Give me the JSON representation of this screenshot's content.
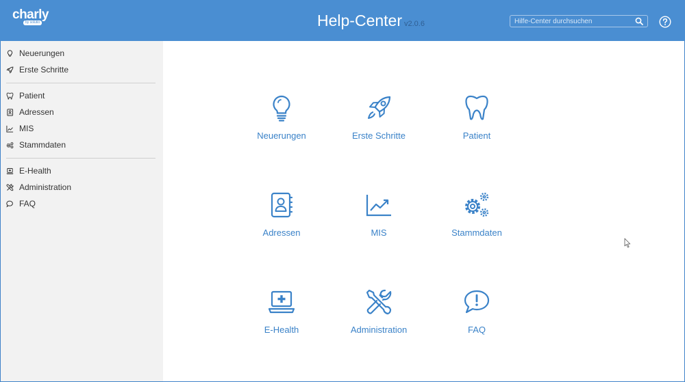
{
  "header": {
    "logo_text": "charly",
    "logo_sub": "by solutio",
    "title": "Help-Center",
    "version": "v2.0.6",
    "search_placeholder": "Hilfe-Center durchsuchen",
    "search_value": ""
  },
  "sidebar": {
    "items": [
      {
        "label": "Neuerungen",
        "icon": "lightbulb-icon"
      },
      {
        "label": "Erste Schritte",
        "icon": "rocket-icon"
      },
      {
        "label": "Patient",
        "icon": "tooth-icon"
      },
      {
        "label": "Adressen",
        "icon": "address-book-icon"
      },
      {
        "label": "MIS",
        "icon": "chart-line-icon"
      },
      {
        "label": "Stammdaten",
        "icon": "gears-icon"
      },
      {
        "label": "E-Health",
        "icon": "laptop-medical-icon"
      },
      {
        "label": "Administration",
        "icon": "tools-icon"
      },
      {
        "label": "FAQ",
        "icon": "speech-bubble-icon"
      }
    ]
  },
  "tiles": [
    {
      "label": "Neuerungen",
      "icon": "lightbulb-icon"
    },
    {
      "label": "Erste Schritte",
      "icon": "rocket-icon"
    },
    {
      "label": "Patient",
      "icon": "tooth-icon"
    },
    {
      "label": "Adressen",
      "icon": "address-book-icon"
    },
    {
      "label": "MIS",
      "icon": "chart-line-icon"
    },
    {
      "label": "Stammdaten",
      "icon": "gears-icon"
    },
    {
      "label": "E-Health",
      "icon": "laptop-medical-icon"
    },
    {
      "label": "Administration",
      "icon": "tools-icon"
    },
    {
      "label": "FAQ",
      "icon": "speech-bubble-icon"
    }
  ],
  "colors": {
    "header_bg": "#4a8ed2",
    "accent": "#3a82c8",
    "sidebar_bg": "#f2f2f2",
    "text": "#333333"
  }
}
